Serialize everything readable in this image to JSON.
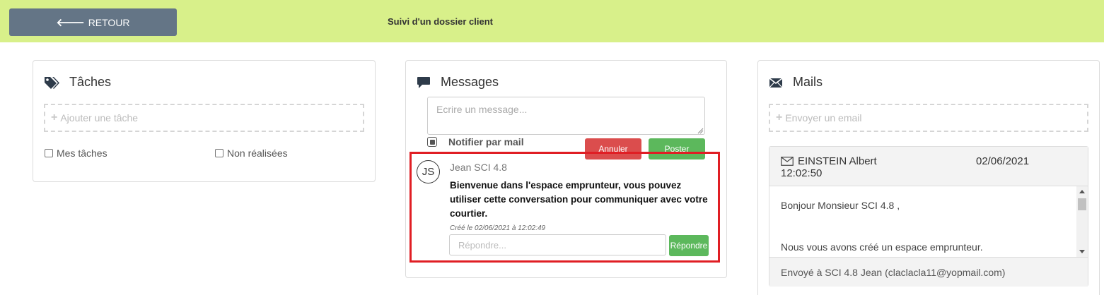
{
  "header": {
    "back_label": "RETOUR",
    "title": "Suivi d'un dossier client"
  },
  "tasks": {
    "title": "Tâches",
    "add_placeholder": "Ajouter une tâche",
    "filters": [
      "Mes tâches",
      "Non réalisées"
    ]
  },
  "messages": {
    "title": "Messages",
    "input_placeholder": "Ecrire un message...",
    "notify_label": "Notifier par mail",
    "cancel_label": "Annuler",
    "post_label": "Poster",
    "thread": {
      "avatar_initials": "JS",
      "author": "Jean SCI 4.8",
      "body": "Bienvenue dans l'espace emprunteur, vous pouvez utiliser cette conversation pour communiquer avec votre courtier.",
      "created": "Créé le 02/06/2021 à 12:02:49",
      "reply_placeholder": "Répondre...",
      "reply_label": "Répondre"
    }
  },
  "mails": {
    "title": "Mails",
    "add_placeholder": "Envoyer un email",
    "card": {
      "sender": "EINSTEIN Albert",
      "date": "02/06/2021",
      "time": "12:02:50",
      "greeting": "Bonjour Monsieur SCI 4.8 ,",
      "line2": "Nous vous avons créé un espace emprunteur.",
      "sent_to": "Envoyé à SCI 4.8 Jean (claclacla11@yopmail.com)"
    }
  },
  "colors": {
    "header_bg": "#d8f08a",
    "back_button": "#647586",
    "cancel": "#db4d4d",
    "post": "#5cb85c",
    "highlight": "#e01e24"
  }
}
